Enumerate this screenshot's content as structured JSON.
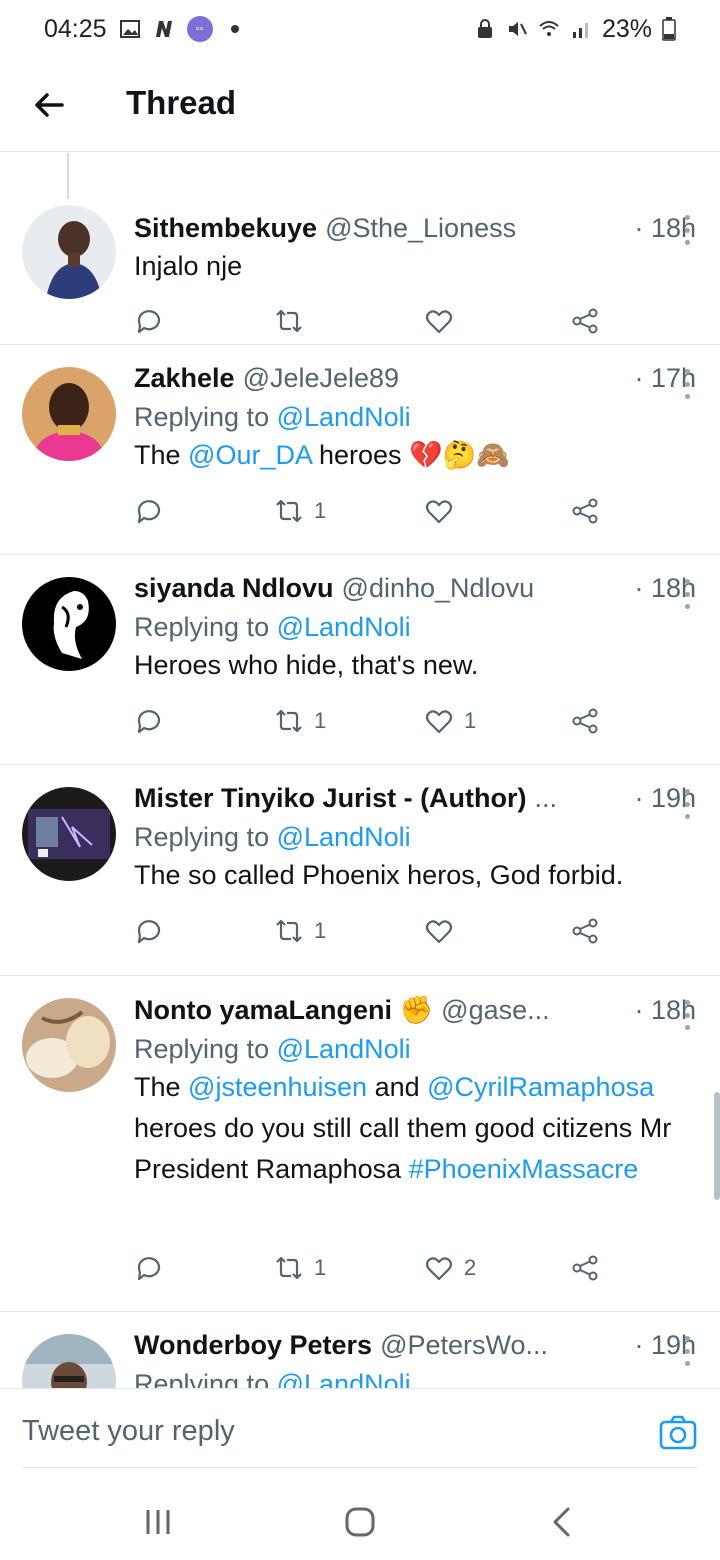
{
  "status_bar": {
    "time": "04:25",
    "battery": "23%"
  },
  "header": {
    "title": "Thread"
  },
  "tweets": [
    {
      "name": "Sithembekuye",
      "handle": "@Sthe_Lioness",
      "time": "· 18h",
      "reply_prefix": "",
      "reply_to": "",
      "body_parts": [
        {
          "t": "Injalo nje",
          "link": false
        }
      ],
      "reply_count": "",
      "retweet_count": "",
      "like_count": ""
    },
    {
      "name": "Zakhele",
      "handle": "@JeleJele89",
      "time": "· 17h",
      "reply_prefix": "Replying to",
      "reply_to": "@LandNoli",
      "body_parts": [
        {
          "t": "The ",
          "link": false
        },
        {
          "t": "@Our_DA",
          "link": true
        },
        {
          "t": " heroes 💔🤔🙈",
          "link": false
        }
      ],
      "reply_count": "",
      "retweet_count": "1",
      "like_count": ""
    },
    {
      "name": "siyanda Ndlovu",
      "handle": "@dinho_Ndlovu",
      "time": "· 18h",
      "reply_prefix": "Replying to",
      "reply_to": "@LandNoli",
      "body_parts": [
        {
          "t": "Heroes who hide, that's new.",
          "link": false
        }
      ],
      "reply_count": "",
      "retweet_count": "1",
      "like_count": "1"
    },
    {
      "name": "Mister Tinyiko Jurist - (Author)",
      "handle": "...",
      "time": "· 19h",
      "reply_prefix": "Replying to",
      "reply_to": "@LandNoli",
      "body_parts": [
        {
          "t": "The so called Phoenix heros, God forbid.",
          "link": false
        }
      ],
      "reply_count": "",
      "retweet_count": "1",
      "like_count": ""
    },
    {
      "name": "Nonto yamaLangeni ✊",
      "handle": "@gase...",
      "time": "· 18h",
      "reply_prefix": "Replying to",
      "reply_to": "@LandNoli",
      "body_parts": [
        {
          "t": "The ",
          "link": false
        },
        {
          "t": "@jsteenhuisen",
          "link": true
        },
        {
          "t": " and ",
          "link": false
        },
        {
          "t": "@CyrilRamaphosa",
          "link": true
        },
        {
          "t": " heroes do you still call them good citizens Mr President Ramaphosa ",
          "link": false
        },
        {
          "t": "#PhoenixMassacre",
          "link": true
        }
      ],
      "reply_count": "",
      "retweet_count": "1",
      "like_count": "2"
    },
    {
      "name": "Wonderboy Peters",
      "handle": "@PetersWo...",
      "time": "· 19h",
      "reply_prefix": "Replying to",
      "reply_to": "@LandNoli",
      "body_parts": [],
      "reply_count": "",
      "retweet_count": "",
      "like_count": ""
    }
  ],
  "reply_bar": {
    "placeholder": "Tweet your reply"
  },
  "colors": {
    "link": "#1d9bf0",
    "secondary_text": "#536471"
  }
}
